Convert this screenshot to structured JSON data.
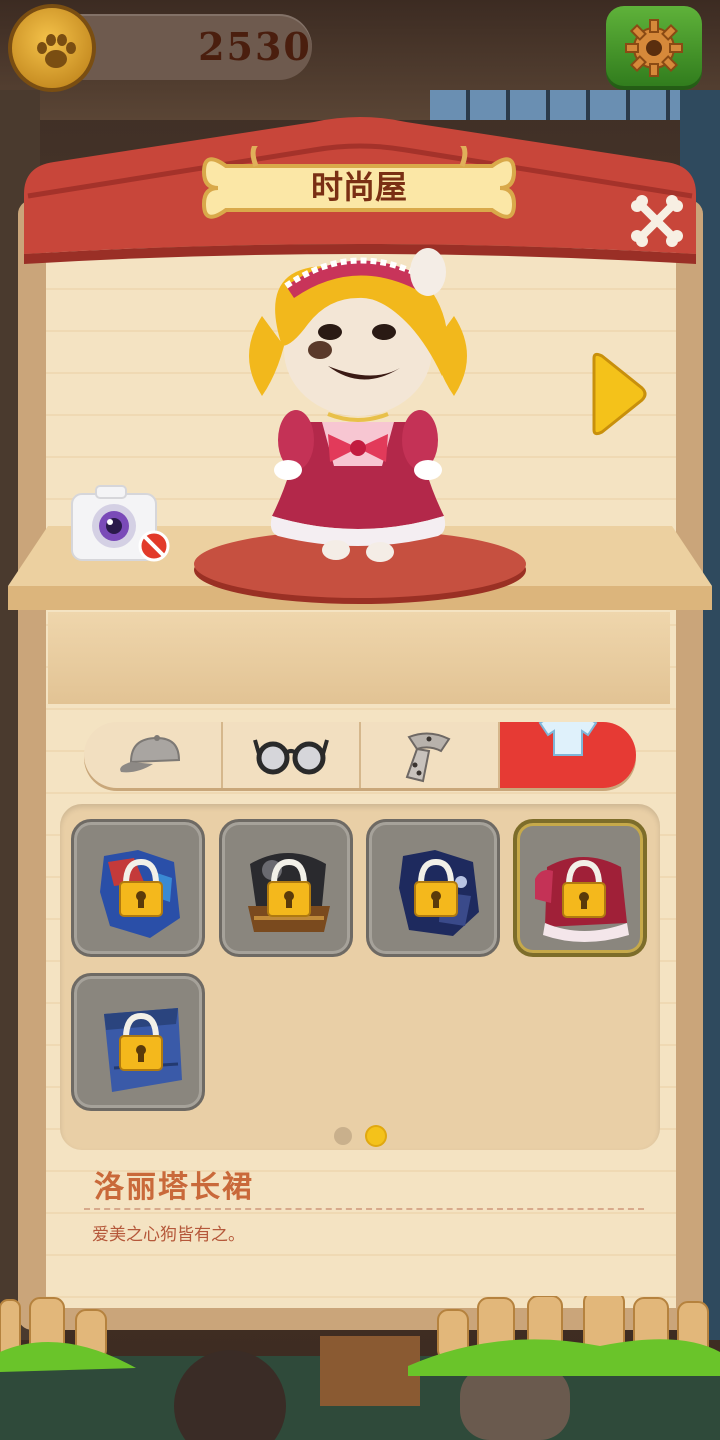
{
  "header": {
    "coin_value": "2530",
    "coin_icon": "paw-coin-icon",
    "settings_icon": "gear-icon"
  },
  "panel": {
    "title": "时尚屋",
    "close_icon": "bone-x-icon",
    "next_icon": "arrow-right-icon",
    "camera_icon": "camera-icon",
    "camera_status_icon": "no-entry-icon"
  },
  "tabs": [
    {
      "name": "hat",
      "icon": "cap-icon",
      "active": false
    },
    {
      "name": "glasses",
      "icon": "glasses-icon",
      "active": false
    },
    {
      "name": "scarf",
      "icon": "scarf-icon",
      "active": false
    },
    {
      "name": "clothes",
      "icon": "shirt-icon",
      "active": true
    }
  ],
  "items": [
    {
      "icon": "blue-patterned-outfit",
      "locked": true,
      "selected": false
    },
    {
      "icon": "dark-armor-outfit",
      "locked": true,
      "selected": false
    },
    {
      "icon": "navy-coat-outfit",
      "locked": true,
      "selected": false
    },
    {
      "icon": "lolita-dress-outfit",
      "locked": true,
      "selected": true
    },
    {
      "icon": "blue-robe-outfit",
      "locked": true,
      "selected": false
    }
  ],
  "pagination": {
    "pages": 2,
    "current": 2
  },
  "selected_item": {
    "name": "洛丽塔长裙",
    "description": "爱美之心狗皆有之。"
  },
  "colors": {
    "active_tab": "#e63a34",
    "roof": "#c8463a",
    "title_text": "#7a2f14",
    "name_text": "#c9693a"
  }
}
